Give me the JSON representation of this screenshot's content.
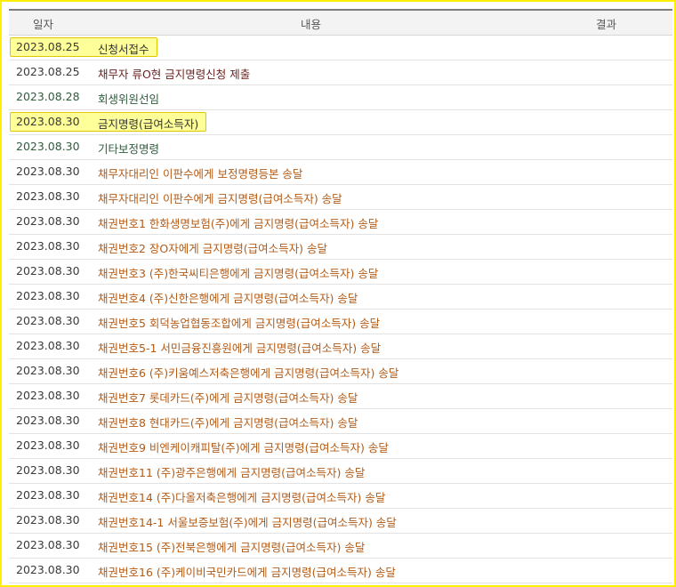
{
  "header": {
    "date": "일자",
    "content": "내용",
    "result": "결과"
  },
  "rows": [
    {
      "date": "2023.08.25",
      "content": "신청서접수",
      "highlight": true,
      "style": "black"
    },
    {
      "date": "2023.08.25",
      "content": "채무자 류O현 금지명령신청 제출",
      "highlight": false,
      "style": "maroon"
    },
    {
      "date": "2023.08.28",
      "content": "회생위원선임",
      "highlight": false,
      "style": "green"
    },
    {
      "date": "2023.08.30",
      "content": "금지명령(급여소득자)",
      "highlight": true,
      "style": "black"
    },
    {
      "date": "2023.08.30",
      "content": "기타보정명령",
      "highlight": false,
      "style": "green"
    },
    {
      "date": "2023.08.30",
      "content": "채무자대리인 이판수에게 보정명령등본 송달",
      "highlight": false,
      "style": "orange"
    },
    {
      "date": "2023.08.30",
      "content": "채무자대리인 이판수에게 금지명령(급여소득자) 송달",
      "highlight": false,
      "style": "orange"
    },
    {
      "date": "2023.08.30",
      "content": "채권번호1 한화생명보험(주)에게 금지명령(급여소득자) 송달",
      "highlight": false,
      "style": "orange"
    },
    {
      "date": "2023.08.30",
      "content": "채권번호2 장O자에게 금지명령(급여소득자) 송달",
      "highlight": false,
      "style": "orange"
    },
    {
      "date": "2023.08.30",
      "content": "채권번호3 (주)한국씨티은행에게 금지명령(급여소득자) 송달",
      "highlight": false,
      "style": "orange"
    },
    {
      "date": "2023.08.30",
      "content": "채권번호4 (주)신한은행에게 금지명령(급여소득자) 송달",
      "highlight": false,
      "style": "orange"
    },
    {
      "date": "2023.08.30",
      "content": "채권번호5 회덕농업협동조합에게 금지명령(급여소득자) 송달",
      "highlight": false,
      "style": "orange"
    },
    {
      "date": "2023.08.30",
      "content": "채권번호5-1 서민금융진흥원에게 금지명령(급여소득자) 송달",
      "highlight": false,
      "style": "orange"
    },
    {
      "date": "2023.08.30",
      "content": "채권번호6 (주)키움예스저축은행에게 금지명령(급여소득자) 송달",
      "highlight": false,
      "style": "orange"
    },
    {
      "date": "2023.08.30",
      "content": "채권번호7 롯데카드(주)에게 금지명령(급여소득자) 송달",
      "highlight": false,
      "style": "orange"
    },
    {
      "date": "2023.08.30",
      "content": "채권번호8 현대카드(주)에게 금지명령(급여소득자) 송달",
      "highlight": false,
      "style": "orange"
    },
    {
      "date": "2023.08.30",
      "content": "채권번호9 비엔케이캐피탈(주)에게 금지명령(급여소득자) 송달",
      "highlight": false,
      "style": "orange"
    },
    {
      "date": "2023.08.30",
      "content": "채권번호11 (주)광주은행에게 금지명령(급여소득자) 송달",
      "highlight": false,
      "style": "orange"
    },
    {
      "date": "2023.08.30",
      "content": "채권번호14 (주)다올저축은행에게 금지명령(급여소득자) 송달",
      "highlight": false,
      "style": "orange"
    },
    {
      "date": "2023.08.30",
      "content": "채권번호14-1 서울보증보험(주)에게 금지명령(급여소득자) 송달",
      "highlight": false,
      "style": "orange"
    },
    {
      "date": "2023.08.30",
      "content": "채권번호15 (주)전북은행에게 금지명령(급여소득자) 송달",
      "highlight": false,
      "style": "orange"
    },
    {
      "date": "2023.08.30",
      "content": "채권번호16 (주)케이비국민카드에게 금지명령(급여소득자) 송달",
      "highlight": false,
      "style": "orange"
    }
  ]
}
